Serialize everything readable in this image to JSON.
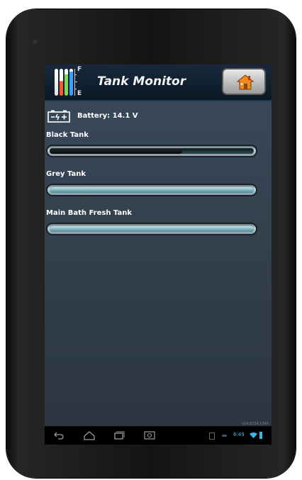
{
  "header": {
    "title": "Tank Monitor",
    "gauge_full_label": "F",
    "gauge_empty_label": "E",
    "home_icon": "home-icon"
  },
  "battery": {
    "text": "Battery: 14.1 V",
    "icon": "battery-icon"
  },
  "tanks": [
    {
      "label": "Black Tank",
      "level": 0.65,
      "fill_color": "#111418"
    },
    {
      "label": "Grey Tank",
      "level": 0.0,
      "fill_color": "#8fc6cf"
    },
    {
      "label": "Main Bath Fresh Tank",
      "level": 0.0,
      "fill_color": "#8fc6cf"
    }
  ],
  "version": "v14.0714.1345",
  "system_bar": {
    "time": "6:49",
    "nav_icons": [
      "back-icon",
      "home-nav-icon",
      "recent-apps-icon",
      "screenshot-icon"
    ]
  },
  "colors": {
    "titlebar": "#0f1f2e",
    "background": "#34414f",
    "accent": "#3fb7e6"
  }
}
